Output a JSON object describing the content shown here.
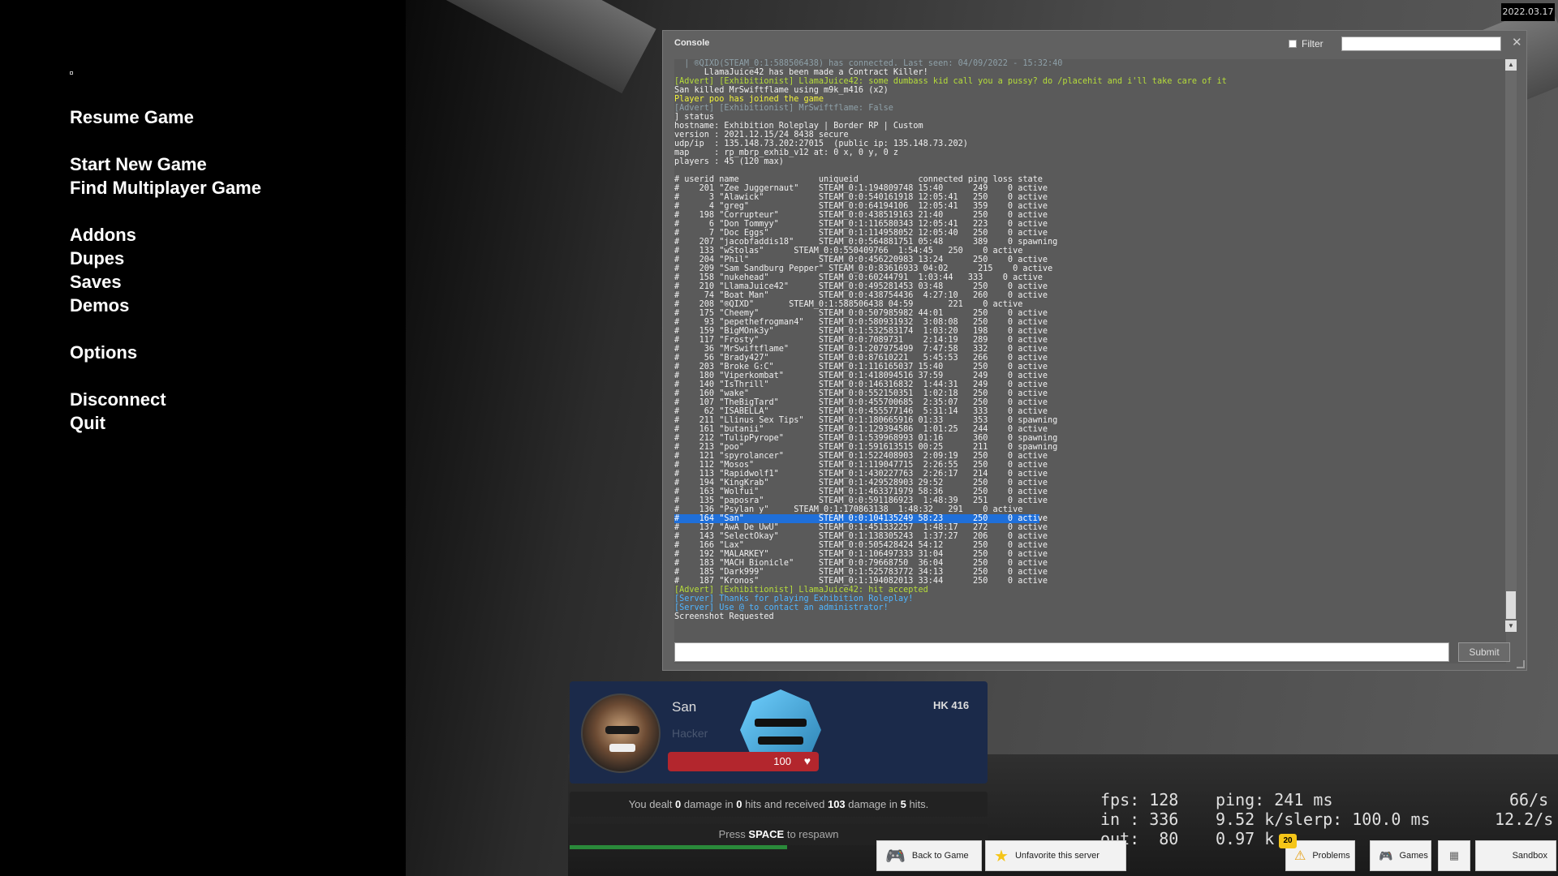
{
  "menu": {
    "resume": "Resume Game",
    "start_new": "Start New Game",
    "find_multiplayer": "Find Multiplayer Game",
    "addons": "Addons",
    "dupes": "Dupes",
    "saves": "Saves",
    "demos": "Demos",
    "options": "Options",
    "disconnect": "Disconnect",
    "quit": "Quit"
  },
  "date_badge": "2022.03.17",
  "console": {
    "title": "Console",
    "filter_label": "Filter",
    "filter_value": "",
    "command_value": "",
    "submit_label": "Submit",
    "close_glyph": "✕",
    "lines": [
      [
        "dim",
        "  | ®QIXD(STEAM_0:1:588506438) has connected. Last seen: 04/09/2022 - 15:32:40"
      ],
      [
        "white",
        "      LlamaJuice42 has been made a Contract Killer!"
      ],
      [
        "advert",
        "[Advert] [Exhibitionist] LlamaJuice42: some dumbass kid call you a pussy? do /placehit and i'll take care of it"
      ],
      [
        "white",
        "San killed MrSwiftflame using m9k_m416 (x2)"
      ],
      [
        "yellow",
        "Player poo has joined the game"
      ],
      [
        "dim",
        "[Advert] [Exhibitionist] MrSwiftflame: False"
      ],
      [
        "white",
        "] status"
      ],
      [
        "white",
        "hostname: Exhibition Roleplay | Border RP | Custom"
      ],
      [
        "white",
        "version : 2021.12.15/24 8438 secure"
      ],
      [
        "white",
        "udp/ip  : 135.148.73.202:27015  (public ip: 135.148.73.202)"
      ],
      [
        "white",
        "map     : rp_mbrp_exhib_v12 at: 0 x, 0 y, 0 z"
      ],
      [
        "white",
        "players : 45 (120 max)"
      ],
      [
        "white",
        ""
      ],
      [
        "white",
        "# userid name                uniqueid            connected ping loss state"
      ],
      [
        "white",
        "#    201 \"Zee Juggernaut\"    STEAM_0:1:194809748 15:40      249    0 active"
      ],
      [
        "white",
        "#      3 \"Alawick\"           STEAM_0:0:540161918 12:05:41   250    0 active"
      ],
      [
        "white",
        "#      4 \"greg\"              STEAM_0:0:64194106  12:05:41   359    0 active"
      ],
      [
        "white",
        "#    198 \"Corrupteur\"        STEAM_0:0:438519163 21:40      250    0 active"
      ],
      [
        "white",
        "#      6 \"Don Tommyy\"        STEAM_0:1:116580343 12:05:41   223    0 active"
      ],
      [
        "white",
        "#      7 \"Doc Eggs\"          STEAM_0:1:114958052 12:05:40   250    0 active"
      ],
      [
        "white",
        "#    207 \"jacobfaddis18\"     STEAM_0:0:564881751 05:48      389    0 spawning"
      ],
      [
        "white",
        "#    133 \"wStolas\"      STEAM_0:0:550409766  1:54:45   250    0 active"
      ],
      [
        "white",
        "#    204 \"Phil\"              STEAM_0:0:456220983 13:24      250    0 active"
      ],
      [
        "white",
        "#    209 \"Sam Sandburg Pepper\" STEAM_0:0:83616933 04:02      215    0 active"
      ],
      [
        "white",
        "#    158 \"nukehead\"          STEAM_0:0:60244791  1:03:44   333    0 active"
      ],
      [
        "white",
        "#    210 \"LlamaJuice42\"      STEAM_0:0:495281453 03:48      250    0 active"
      ],
      [
        "white",
        "#     74 \"Boat Man\"          STEAM_0:0:438754436  4:27:10   260    0 active"
      ],
      [
        "white",
        "#    208 \"®QIXD\"       STEAM_0:1:588506438 04:59       221    0 active"
      ],
      [
        "white",
        "#    175 \"Cheemy\"            STEAM_0:0:507985982 44:01      250    0 active"
      ],
      [
        "white",
        "#     93 \"pepethefrogman4\"   STEAM_0:0:580931932  3:08:08   250    0 active"
      ],
      [
        "white",
        "#    159 \"BigMOnk3y\"         STEAM_0:1:532583174  1:03:20   198    0 active"
      ],
      [
        "white",
        "#    117 \"Frosty\"            STEAM_0:0:7089731    2:14:19   289    0 active"
      ],
      [
        "white",
        "#     36 \"MrSwiftflame\"      STEAM_0:1:207975499  7:47:58   332    0 active"
      ],
      [
        "white",
        "#     56 \"Brady427\"          STEAM_0:0:87610221   5:45:53   266    0 active"
      ],
      [
        "white",
        "#    203 \"Broke G:C\"         STEAM_0:1:116165037 15:40      250    0 active"
      ],
      [
        "white",
        "#    180 \"Viperkombat\"       STEAM_0:1:418094516 37:59      249    0 active"
      ],
      [
        "white",
        "#    140 \"IsThrill\"          STEAM_0:0:146316832  1:44:31   249    0 active"
      ],
      [
        "white",
        "#    160 \"wake\"              STEAM_0:0:552150351  1:02:18   250    0 active"
      ],
      [
        "white",
        "#    107 \"TheBigTard\"        STEAM_0:0:455700685  2:35:07   250    0 active"
      ],
      [
        "white",
        "#     62 \"ISABELLA\"          STEAM_0:0:455577146  5:31:14   333    0 active"
      ],
      [
        "white",
        "#    211 \"Llinus Sex Tips\"   STEAM_0:1:180665916 01:33      353    0 spawning"
      ],
      [
        "white",
        "#    161 \"butanii\"           STEAM_0:1:129394586  1:01:25   244    0 active"
      ],
      [
        "white",
        "#    212 \"TulipPyrope\"       STEAM_0:1:539968993 01:16      360    0 spawning"
      ],
      [
        "white",
        "#    213 \"poo\"               STEAM_0:1:591613515 00:25      211    0 spawning"
      ],
      [
        "white",
        "#    121 \"spyrolancer\"       STEAM_0:1:522408903  2:09:19   250    0 active"
      ],
      [
        "white",
        "#    112 \"Mosos\"             STEAM_0:1:119047715  2:26:55   250    0 active"
      ],
      [
        "white",
        "#    113 \"Rapidwolf1\"        STEAM_0:1:430227763  2:26:17   214    0 active"
      ],
      [
        "white",
        "#    194 \"KingKrab\"          STEAM_0:1:429528903 29:52      250    0 active"
      ],
      [
        "white",
        "#    163 \"Wolfui\"            STEAM_0:1:463371979 58:36      250    0 active"
      ],
      [
        "white",
        "#    135 \"paposra\"           STEAM_0:0:591186923  1:48:39   251    0 active"
      ],
      [
        "white",
        "#    136 \"Psylan y\"     STEAM_0:1:170863138  1:48:32   291    0 active"
      ],
      [
        "selected",
        "#    164 \"San\"               STEAM_0:0:104135249 58:23      250    0 active"
      ],
      [
        "white",
        "#    137 \"AwA De UwU\"        STEAM_0:1:451332257  1:48:17   272    0 active"
      ],
      [
        "white",
        "#    143 \"SelectOkay\"        STEAM_0:1:138305243  1:37:27   206    0 active"
      ],
      [
        "white",
        "#    166 \"Lax\"               STEAM_0:0:505428424 54:12      250    0 active"
      ],
      [
        "white",
        "#    192 \"MALARKEY\"          STEAM_0:1:106497333 31:04      250    0 active"
      ],
      [
        "white",
        "#    183 \"MACH Bionicle\"     STEAM_0:0:79668750  36:04      250    0 active"
      ],
      [
        "white",
        "#    185 \"Dark999\"           STEAM_0:1:525783772 34:13      250    0 active"
      ],
      [
        "white",
        "#    187 \"Kronos\"            STEAM_0:1:194082013 33:44      250    0 active"
      ],
      [
        "advert",
        "[Advert] [Exhibitionist] LlamaJuice42: hit accepted"
      ],
      [
        "server",
        "[Server] Thanks for playing Exhibition Roleplay!"
      ],
      [
        "server",
        "[Server] Use @ to contact an administrator!"
      ],
      [
        "white",
        "Screenshot Requested"
      ]
    ]
  },
  "killer": {
    "name": "San",
    "role": "Hacker",
    "weapon": "HK 416",
    "health": "100",
    "health_fraction": 1.0
  },
  "damage": {
    "prefix": "You dealt ",
    "dealt": "0",
    "mid1": " damage in ",
    "hits_dealt": "0",
    "mid2": " hits and received ",
    "received": "103",
    "mid3": " damage in ",
    "hits_received": "5",
    "suffix": " hits."
  },
  "respawn": {
    "prefix": "Press ",
    "key": "SPACE",
    "suffix": " to respawn",
    "progress": 0.52
  },
  "netgraph": {
    "fps": "fps: 128",
    "ping": "ping: 241 ms",
    "rate1": "66/s",
    "in": "in : 336",
    "ks_in": "9.52 k/s",
    "lerp": "lerp: 100.0 ms",
    "rate2": "12.2/s",
    "out": "out:  80",
    "ks_out": "0.97 k"
  },
  "taskbar": {
    "back_to_game": "Back to Game",
    "unfavorite": "Unfavorite this server",
    "problems": "Problems",
    "problems_count": "20",
    "games": "Games",
    "sandbox": "Sandbox"
  },
  "colors": {
    "selection": "#1f6fd9",
    "health": "#b3262d",
    "card_bg": "#1b2a4a",
    "advert": "#b6dd3a",
    "server": "#4fb4ff"
  }
}
